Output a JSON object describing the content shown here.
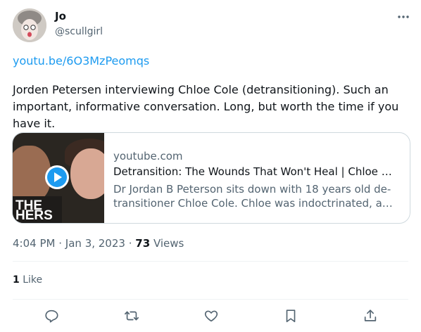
{
  "author": {
    "name": "Jo",
    "handle": "@scullgirl"
  },
  "tweet": {
    "link": "youtu.be/6O3MzPeomqs",
    "text": "Jorden Petersen interviewing Chloe Cole (detransitioning). Such an important, informative conversation. Long, but worth the time if you have it."
  },
  "card": {
    "domain": "youtube.com",
    "title": "Detransition: The Wounds That Won't Heal | Chloe Cole | E...",
    "description_line1": "Dr Jordan B Peterson sits down with 18 years old de-",
    "description_line2": "transitioner Chloe Cole. Chloe was indoctrinated, affirme...",
    "thumbnail_overlay_line1": "THE",
    "thumbnail_overlay_line2": "HERS"
  },
  "meta": {
    "time": "4:04 PM",
    "separator1": "·",
    "date": "Jan 3, 2023",
    "separator2": "·",
    "views_count": "73",
    "views_label": "Views"
  },
  "likes": {
    "count": "1",
    "label": "Like"
  },
  "actions": [
    "reply-icon",
    "retweet-icon",
    "like-icon",
    "bookmark-icon",
    "share-icon"
  ],
  "colors": {
    "link": "#1d9bf0",
    "secondary_text": "#536471",
    "border": "#cfd9de",
    "play_button": "#1d9bf0"
  }
}
